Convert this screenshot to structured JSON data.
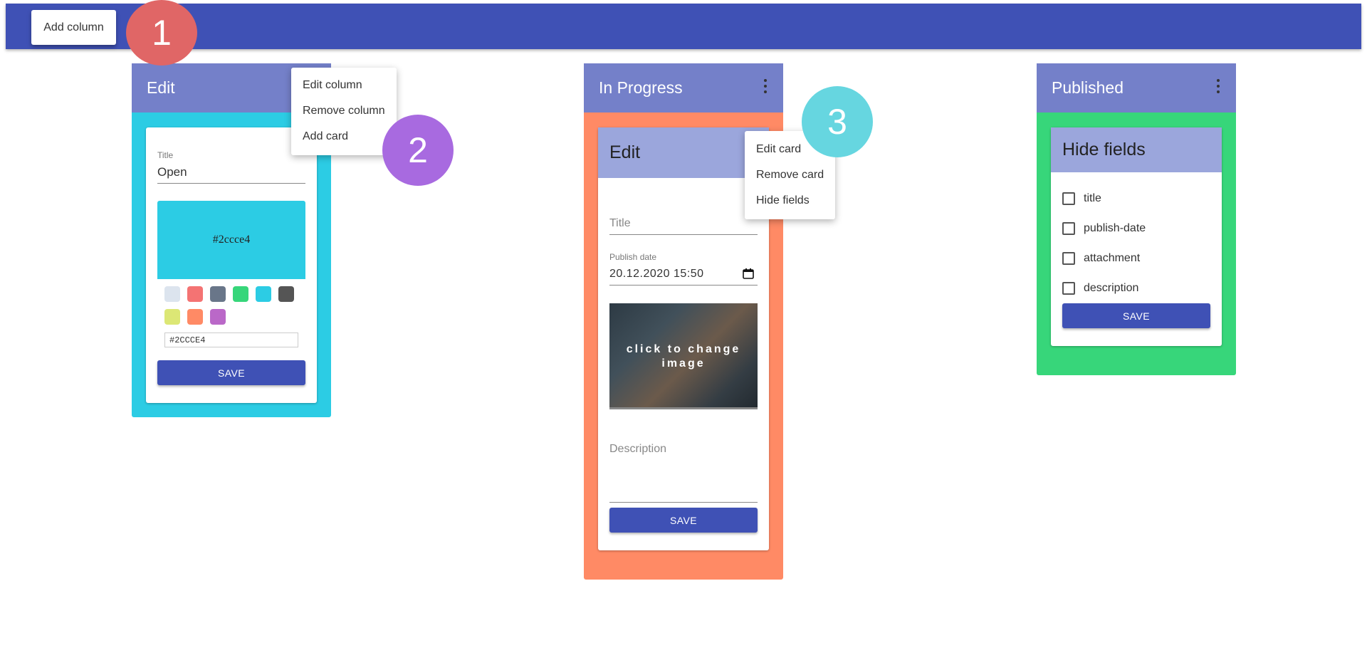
{
  "toolbar": {
    "add_column_label": "Add column"
  },
  "markers": [
    "1",
    "2",
    "3"
  ],
  "columns": [
    {
      "title": "Edit",
      "color": "#2ccce4",
      "menu": [
        "Edit column",
        "Remove column",
        "Add card"
      ],
      "edit_form": {
        "title_label": "Title",
        "title_value": "Open",
        "preview_color_text": "#2ccce4",
        "hex_value": "#2CCCE4",
        "swatches": [
          "#dce4ee",
          "#f47373",
          "#697689",
          "#37d67a",
          "#2ccce4",
          "#555555",
          "#dce775",
          "#ff8a65",
          "#ba68c8"
        ],
        "save_label": "SAVE"
      }
    },
    {
      "title": "In Progress",
      "color": "#ff8a65",
      "card": {
        "header": "Edit",
        "title_placeholder": "Title",
        "publish_label": "Publish date",
        "publish_value": "20.12.2020 15:50",
        "image_text": "click to change image",
        "description_placeholder": "Description",
        "save_label": "SAVE",
        "menu": [
          "Edit card",
          "Remove card",
          "Hide fields"
        ]
      }
    },
    {
      "title": "Published",
      "color": "#37d67a",
      "card": {
        "header": "Hide fields",
        "fields": [
          "title",
          "publish-date",
          "attachment",
          "description"
        ],
        "save_label": "SAVE"
      }
    }
  ],
  "colors": {
    "appbar": "#3f51b5",
    "column_header": "#7480c9",
    "card_header": "#9ba6dc",
    "marker_1": "#e06666",
    "marker_2": "#a86ae0",
    "marker_3": "#66d6e0"
  }
}
